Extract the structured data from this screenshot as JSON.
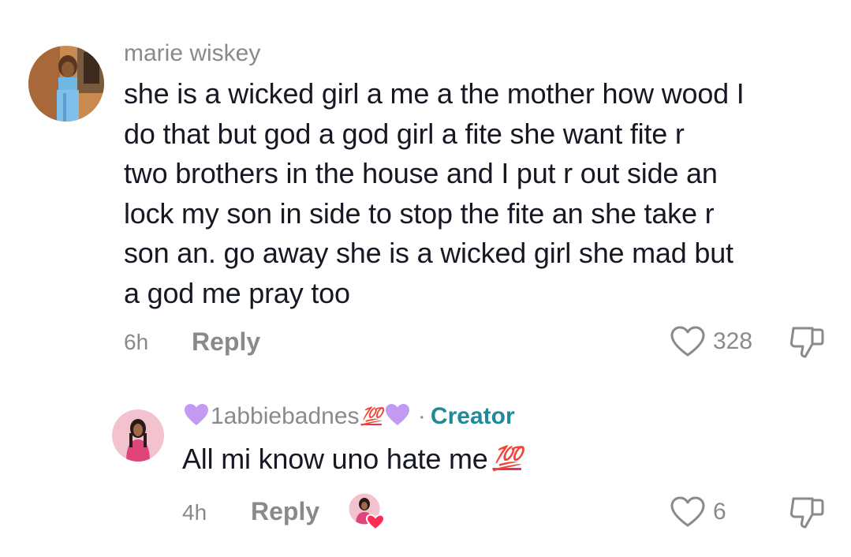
{
  "comments": [
    {
      "username": "marie wiskey",
      "text_lines": [
        "she is a wicked girl a me a the mother how wood I",
        "do that but god a god girl a fite she want fite r",
        "two brothers in the house and I put r out side an",
        "lock my son in side to stop the fite an she take r",
        "son an. go away she is a wicked girl she mad but",
        "a god me pray too"
      ],
      "time": "6h",
      "reply_label": "Reply",
      "likes": "328"
    }
  ],
  "reply": {
    "username": "1abbiebadnes",
    "username_emoji": "💯",
    "separator": "·",
    "creator_label": "Creator",
    "text": "All mi know uno hate me",
    "text_emoji": "💯",
    "time": "4h",
    "reply_label": "Reply",
    "likes": "6"
  },
  "colors": {
    "secondary_text": "#8a8a8a",
    "primary_text": "#161823",
    "creator_accent": "#1f8a99",
    "purple_heart": "#c39af2",
    "hundred_red": "#e8334a",
    "liked_heart": "#fe2c55"
  },
  "icons": {
    "like": "heart-outline-icon",
    "dislike": "thumbs-down-icon",
    "purple_heart": "purple-heart-emoji",
    "hundred": "hundred-points-emoji",
    "creator_liked": "creator-liked-heart-avatar"
  }
}
